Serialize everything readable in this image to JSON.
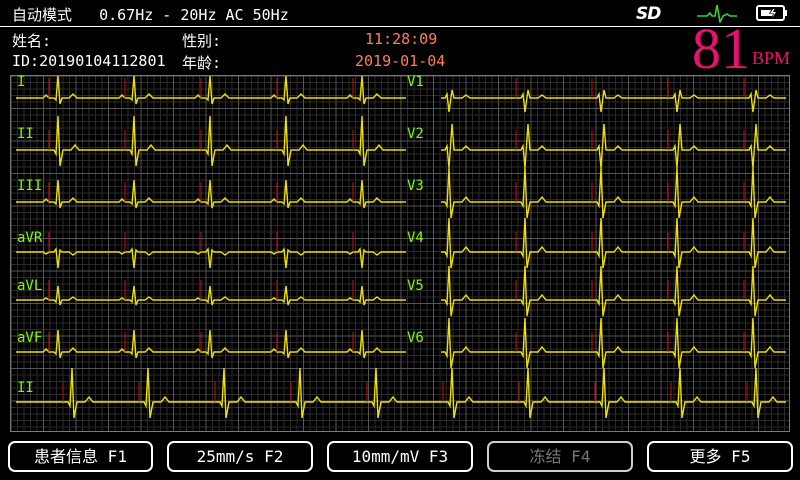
{
  "status_bar": {
    "mode": "自动模式   0.67Hz - 20Hz AC 50Hz",
    "sd_icon_text": "SD",
    "icons": [
      "sd-card-icon",
      "heart-rhythm-icon",
      "battery-icon"
    ]
  },
  "patient": {
    "name_label": "姓名:",
    "gender_label": "性别:",
    "id_text": "ID:20190104112801",
    "age_label": "年龄:",
    "time": "11:28:09",
    "date": "2019-01-04"
  },
  "heart_rate": {
    "value": "81",
    "unit": "BPM"
  },
  "leads": {
    "left": [
      "I",
      "II",
      "III",
      "aVR",
      "aVL",
      "aVF"
    ],
    "right": [
      "V1",
      "V2",
      "V3",
      "V4",
      "V5",
      "V6"
    ],
    "rhythm": "II"
  },
  "buttons": [
    {
      "label": "患者信息 F1",
      "disabled": false
    },
    {
      "label": "25mm/s F2",
      "disabled": false
    },
    {
      "label": "10mm/mV F3",
      "disabled": false
    },
    {
      "label": "冻结 F4",
      "disabled": true
    },
    {
      "label": "更多 F5",
      "disabled": false
    }
  ],
  "colors": {
    "background": "#000000",
    "trace": "#f0e000",
    "pace_marker": "#d01010",
    "lead_label": "#7cfc00",
    "heart_rate": "#e8116e",
    "time_date": "#ff7f4f"
  }
}
